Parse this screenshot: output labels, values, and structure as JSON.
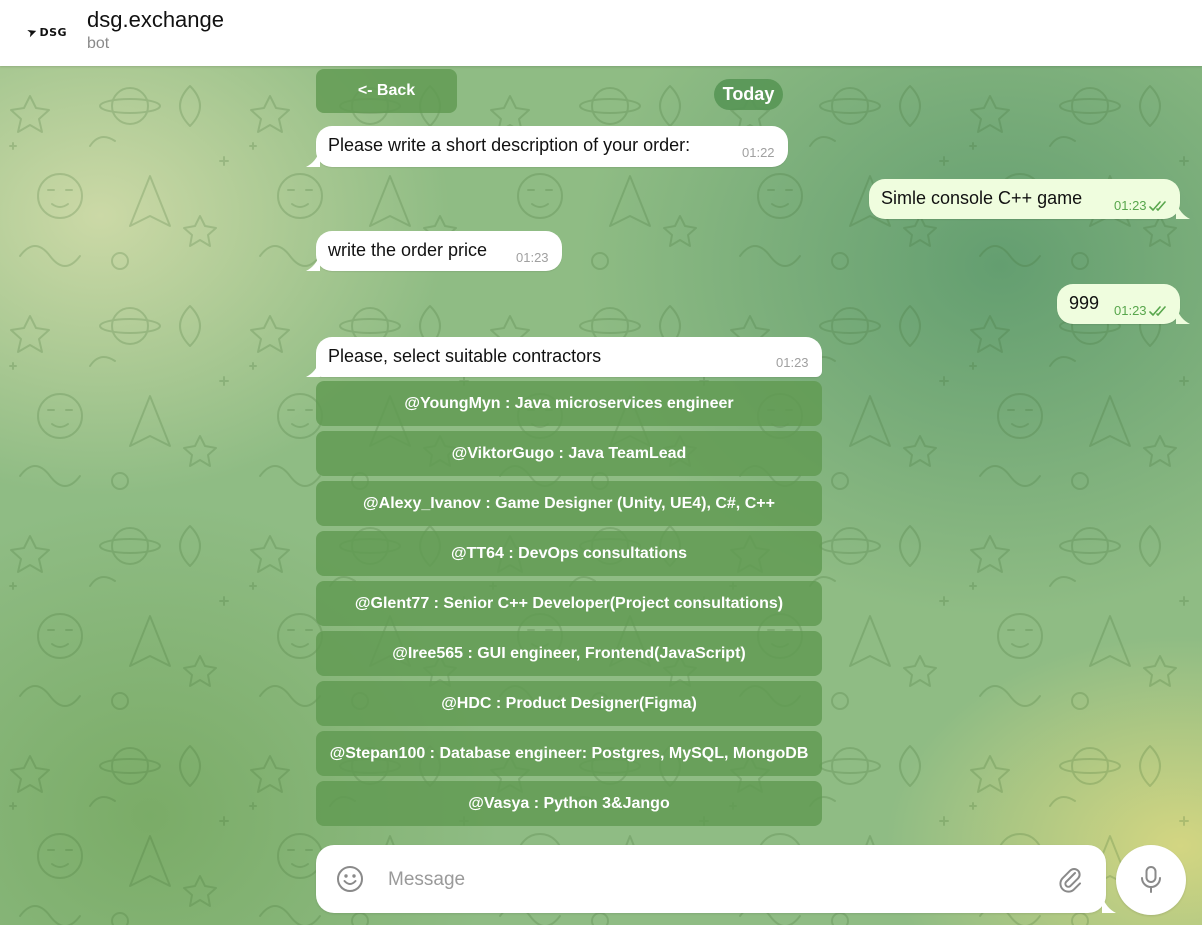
{
  "header": {
    "avatar_text": "DSG",
    "title": "dsg.exchange",
    "subtitle": "bot"
  },
  "chat": {
    "back_button": "<- Back",
    "date_badge": "Today",
    "messages": [
      {
        "direction": "in",
        "text": "Please write a short description of your order:",
        "time": "01:22"
      },
      {
        "direction": "out",
        "text": "Simle console C++ game",
        "time": "01:23"
      },
      {
        "direction": "in",
        "text": "write the order price",
        "time": "01:23"
      },
      {
        "direction": "out",
        "text": "999",
        "time": "01:23"
      },
      {
        "direction": "in",
        "text": "Please, select suitable contractors",
        "time": "01:23"
      }
    ],
    "contractors": [
      "@YoungMyn : Java microservices engineer",
      "@ViktorGugo : Java TeamLead",
      "@Alexy_Ivanov : Game Designer (Unity, UE4), C#, C++",
      "@TT64 : DevOps consultations",
      "@Glent77 : Senior C++ Developer(Project consultations)",
      "@Iree565 : GUI engineer, Frontend(JavaScript)",
      "@HDC : Product Designer(Figma)",
      "@Stepan100 : Database engineer: Postgres, MySQL, MongoDB",
      "@Vasya : Python 3&Jango"
    ]
  },
  "composer": {
    "placeholder": "Message",
    "icons": [
      "smile-icon",
      "paperclip-icon",
      "microphone-icon"
    ]
  },
  "colors": {
    "inline_button": "#609a52",
    "outgoing_bubble": "#effdde",
    "outgoing_time": "#58a64c"
  }
}
